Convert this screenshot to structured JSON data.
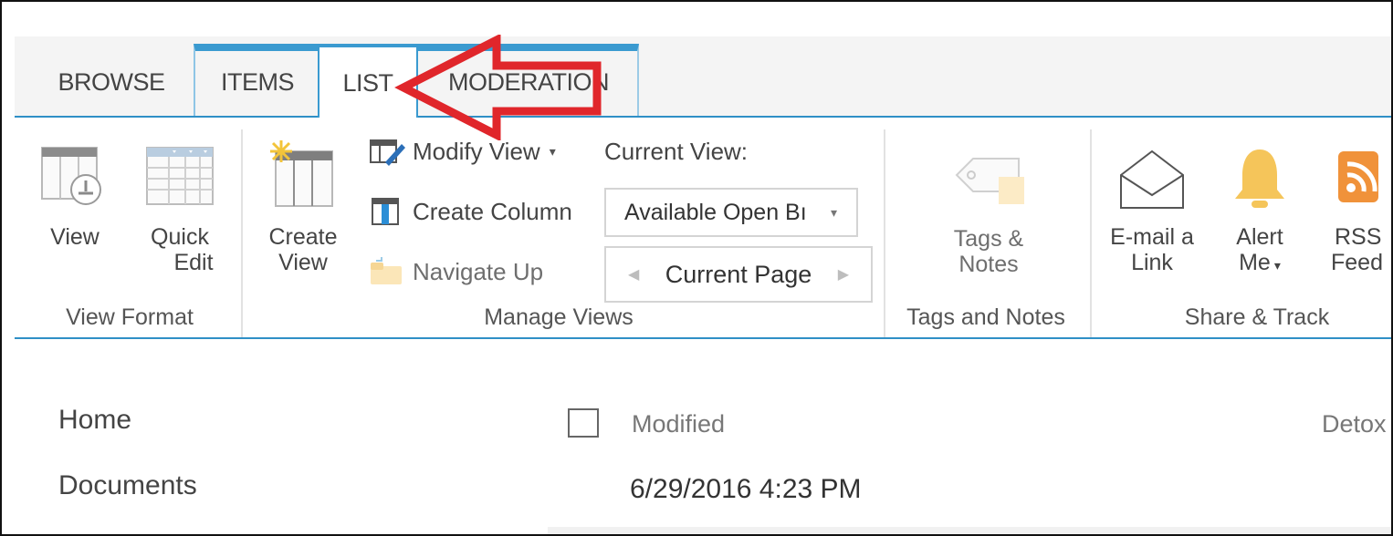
{
  "tabs": [
    {
      "label": "BROWSE"
    },
    {
      "label": "ITEMS"
    },
    {
      "label": "LIST",
      "active": true
    },
    {
      "label": "MODERATION"
    }
  ],
  "ribbon": {
    "view_format": {
      "label": "View Format",
      "view": {
        "label": "View",
        "icon": "table-view-icon"
      },
      "quick_edit": {
        "label_line1": "Quick",
        "label_line2": "Edit",
        "icon": "datasheet-icon"
      }
    },
    "manage_views": {
      "label": "Manage Views",
      "create_view": {
        "label_line1": "Create",
        "label_line2": "View",
        "icon": "create-view-icon"
      },
      "modify_view": {
        "label": "Modify View",
        "icon": "modify-view-icon"
      },
      "create_column": {
        "label": "Create Column",
        "icon": "create-column-icon"
      },
      "navigate_up": {
        "label": "Navigate Up",
        "icon": "folder-up-icon"
      },
      "current_view_label": "Current View:",
      "current_view_value": "Available Open Bı",
      "current_page": "Current Page"
    },
    "tags_notes": {
      "label": "Tags and Notes",
      "button": {
        "label_line1": "Tags &",
        "label_line2": "Notes",
        "icon": "tag-icon"
      }
    },
    "share_track": {
      "label": "Share & Track",
      "email": {
        "label_line1": "E-mail a",
        "label_line2": "Link",
        "icon": "envelope-icon"
      },
      "alert": {
        "label_line1": "Alert",
        "label_line2": "Me",
        "icon": "bell-icon"
      },
      "rss": {
        "label_line1": "RSS",
        "label_line2": "Feed",
        "icon": "rss-icon"
      }
    }
  },
  "nav": {
    "items": [
      {
        "label": "Home"
      },
      {
        "label": "Documents"
      }
    ]
  },
  "list": {
    "columns": [
      {
        "label": "Modified"
      },
      {
        "label": "Detox"
      }
    ],
    "rows": [
      {
        "modified": "6/29/2016 4:23 PM"
      }
    ]
  },
  "colors": {
    "accent": "#2f8fc6",
    "annotation_arrow": "#e0262b",
    "bell": "#f5c55a",
    "rss": "#f0923a"
  }
}
